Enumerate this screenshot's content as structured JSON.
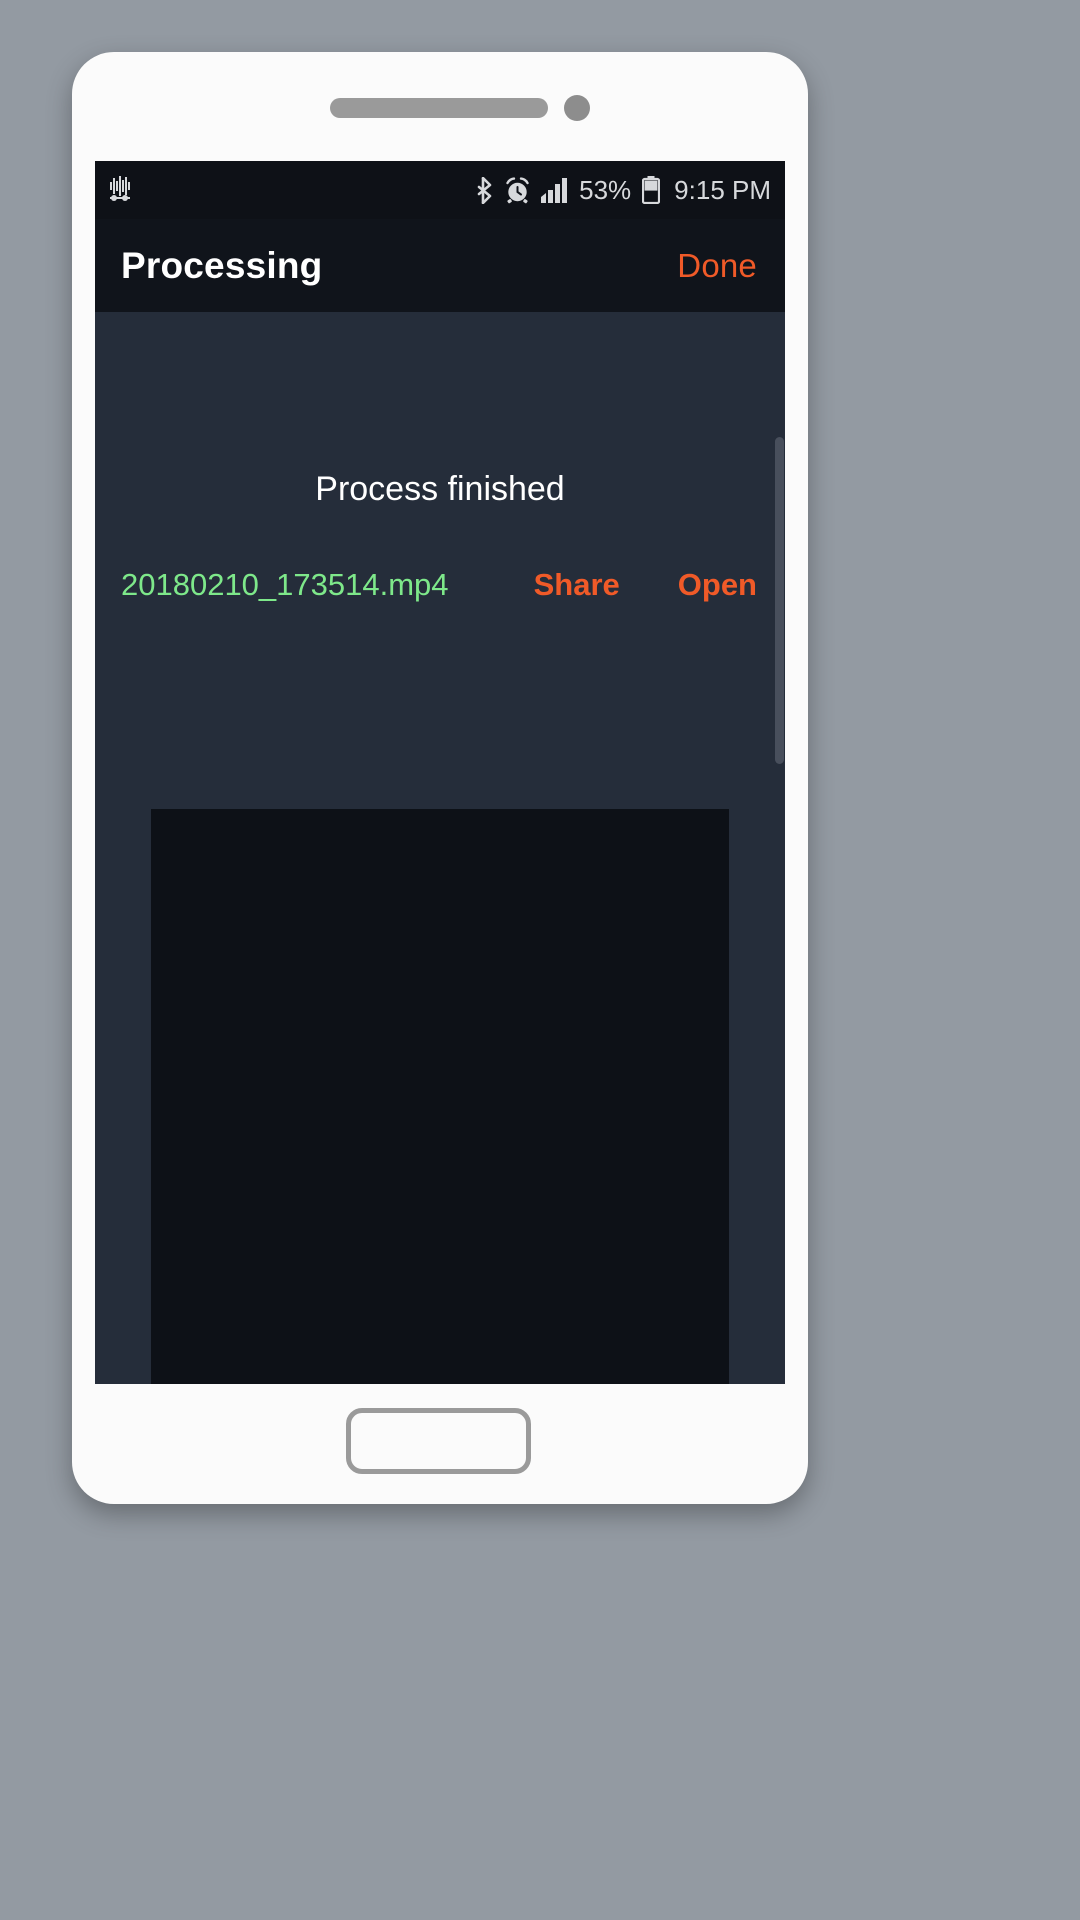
{
  "device": {
    "frame_name": "smartphone-frame",
    "bezel_color": "#fbfbfb",
    "background_color": "#939aa2"
  },
  "statusbar": {
    "left_icons": [
      {
        "name": "equalizer-icon",
        "glyph": "equalizer"
      }
    ],
    "right_icons": [
      {
        "name": "bluetooth-icon",
        "glyph": "bluetooth"
      },
      {
        "name": "alarm-icon",
        "glyph": "alarm-clock"
      },
      {
        "name": "signal-icon",
        "glyph": "cellular-signal"
      }
    ],
    "battery_percent": "53%",
    "battery_icon": "battery-half-icon",
    "time": "9:15 PM",
    "background_color": "#0e1117",
    "text_color": "#d7d9dc"
  },
  "appbar": {
    "title": "Processing",
    "action_label": "Done",
    "background_color": "#10141b",
    "title_color": "#ffffff",
    "accent_color": "#f05a28"
  },
  "content": {
    "status_message": "Process finished",
    "result": {
      "filename": "20180210_173514.mp4",
      "filename_color": "#7ee88a",
      "actions": [
        {
          "name": "share-button",
          "label": "Share"
        },
        {
          "name": "open-button",
          "label": "Open"
        }
      ]
    },
    "preview_background": "#0d1117",
    "background_color": "#252d3a"
  }
}
